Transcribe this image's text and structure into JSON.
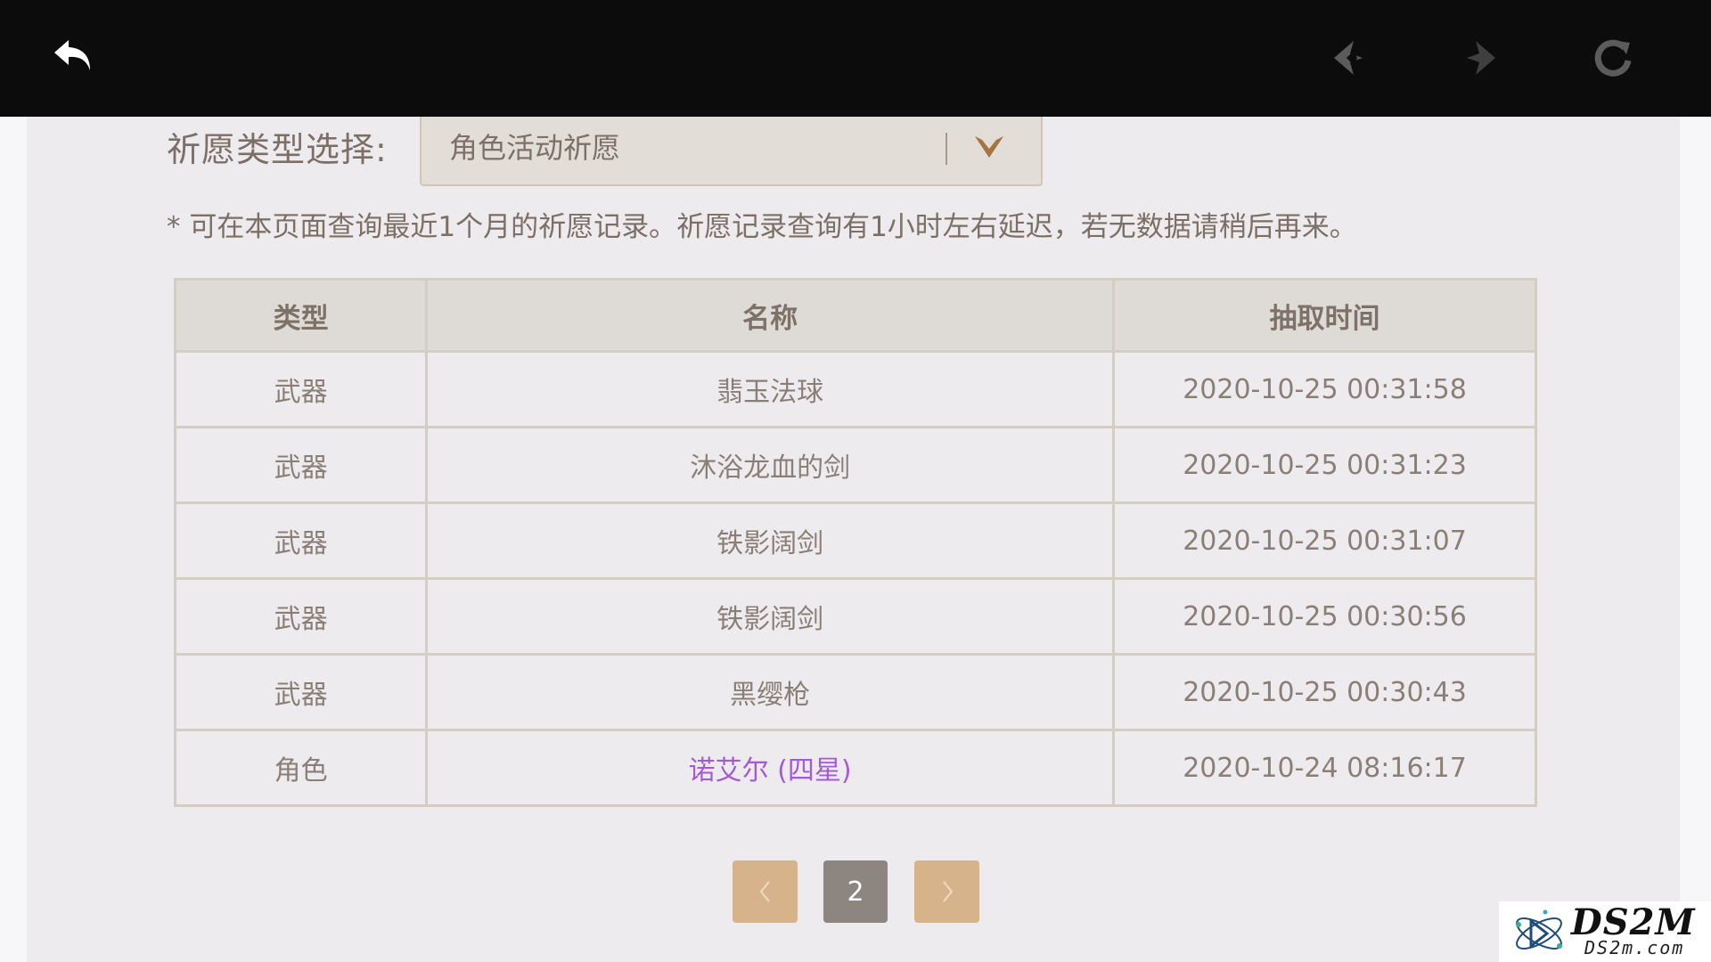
{
  "topbar": {
    "back_icon": "undo-arrow-icon",
    "prev_icon": "diamond-left-arrow-icon",
    "next_icon": "diamond-right-arrow-icon",
    "refresh_icon": "refresh-icon"
  },
  "filter": {
    "label": "祈愿类型选择:",
    "selected": "角色活动祈愿"
  },
  "note": "* 可在本页面查询最近1个月的祈愿记录。祈愿记录查询有1小时左右延迟，若无数据请稍后再来。",
  "table": {
    "headers": [
      "类型",
      "名称",
      "抽取时间"
    ],
    "rows": [
      {
        "type": "武器",
        "name": "翡玉法球",
        "time": "2020-10-25 00:31:58"
      },
      {
        "type": "武器",
        "name": "沐浴龙血的剑",
        "time": "2020-10-25 00:31:23"
      },
      {
        "type": "武器",
        "name": "铁影阔剑",
        "time": "2020-10-25 00:31:07"
      },
      {
        "type": "武器",
        "name": "铁影阔剑",
        "time": "2020-10-25 00:30:56"
      },
      {
        "type": "武器",
        "name": "黑缨枪",
        "time": "2020-10-25 00:30:43"
      },
      {
        "type": "角色",
        "name": "诺艾尔 (四星)",
        "time": "2020-10-24 08:16:17"
      }
    ]
  },
  "pagination": {
    "prev": "‹",
    "current": "2",
    "next": "›"
  },
  "watermark": {
    "brand": "DS2M",
    "domain": "DS2m.com"
  },
  "colors": {
    "purple_item": "#a25bd4",
    "pager_button": "#d6b38a",
    "pager_current": "#8d8680"
  }
}
